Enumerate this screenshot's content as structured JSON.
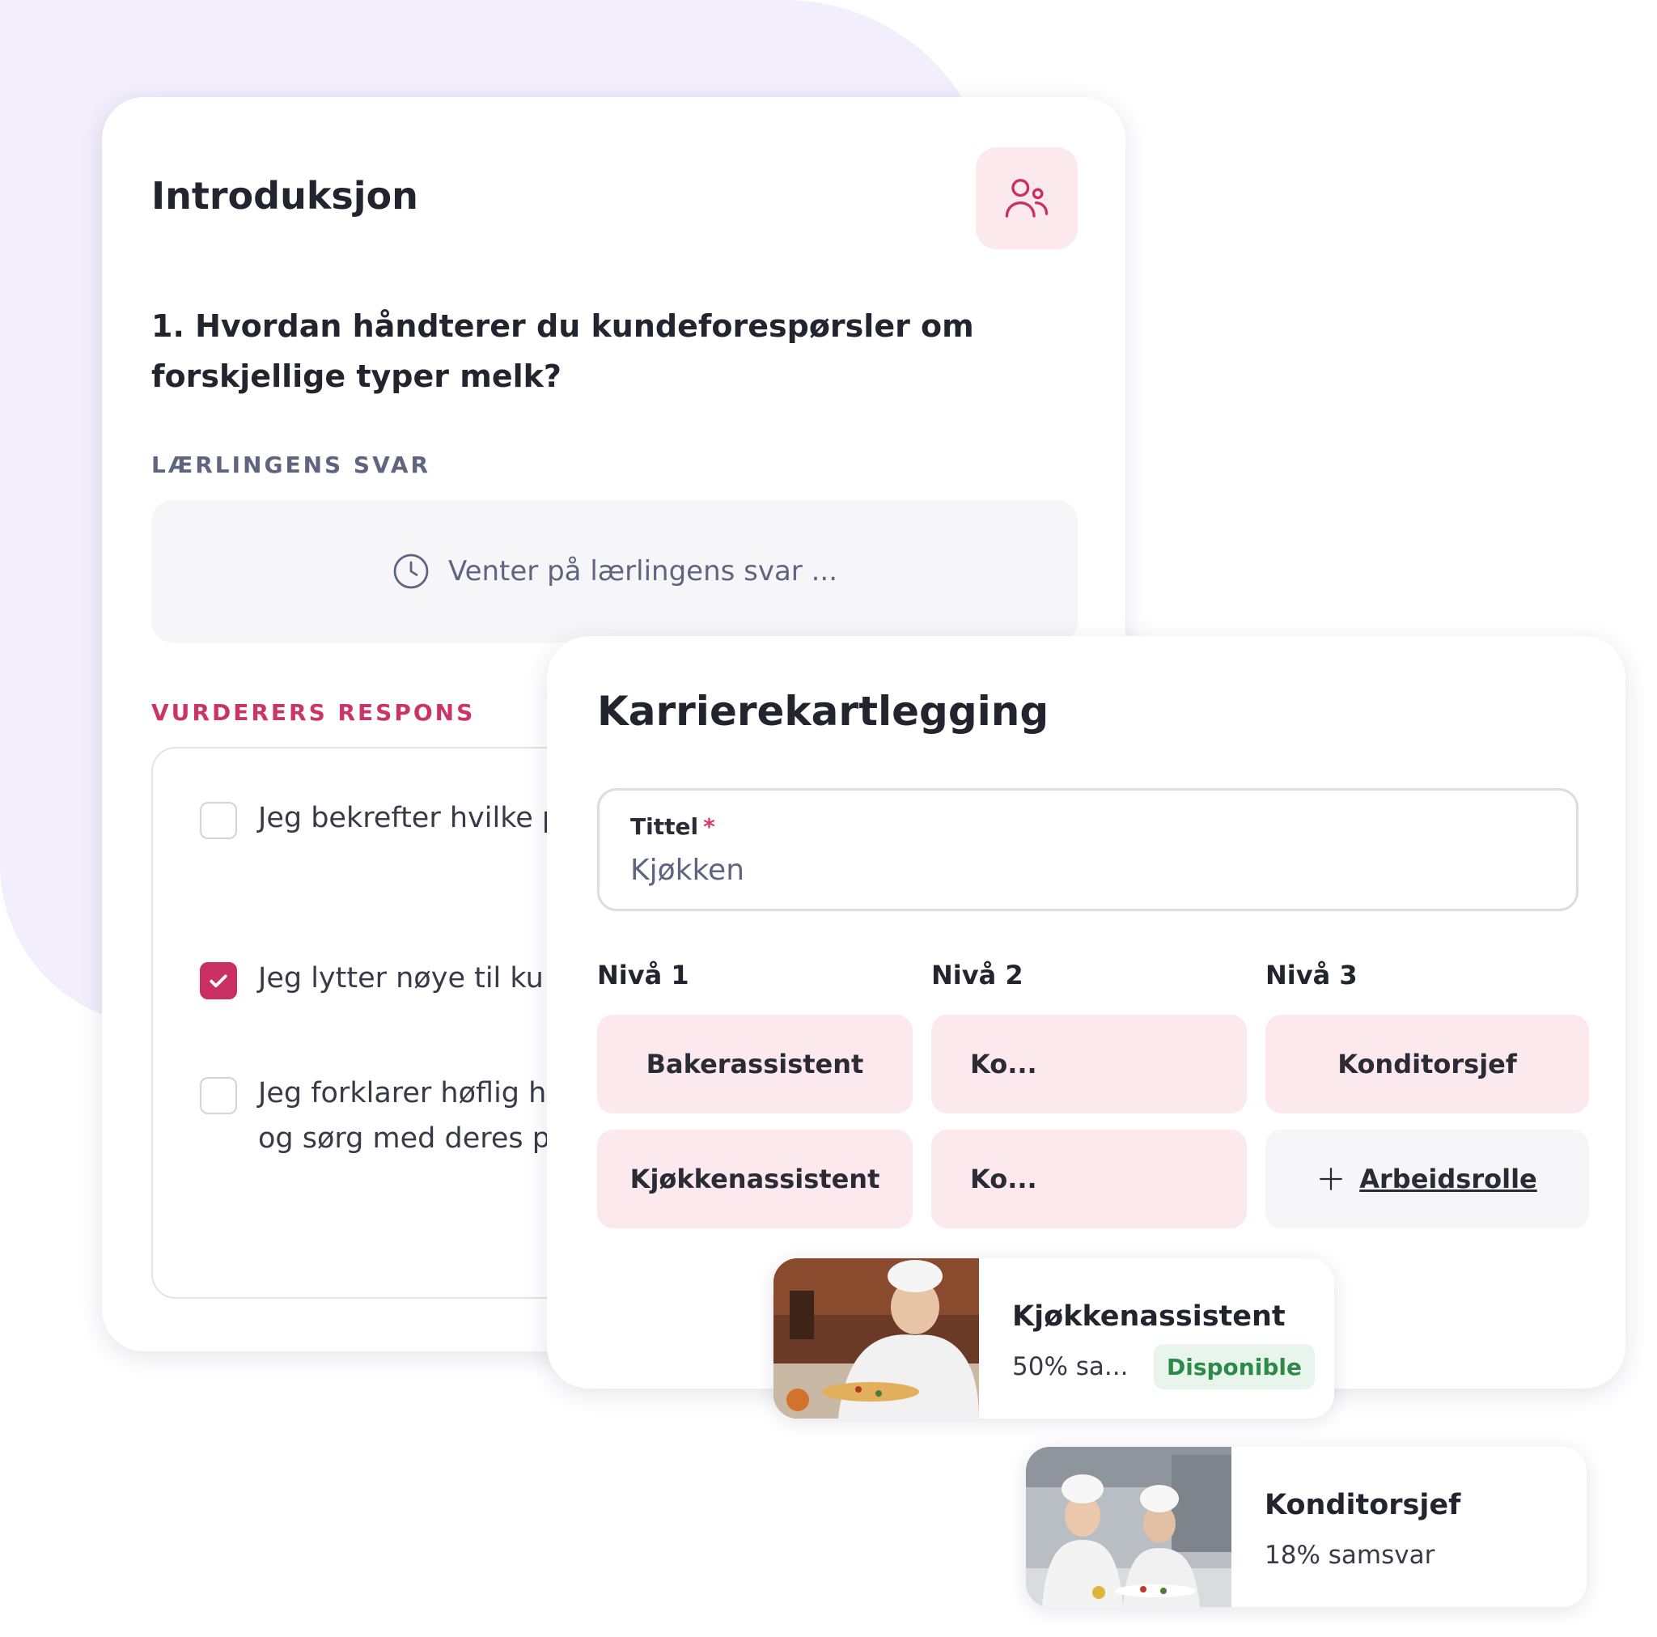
{
  "intro_card": {
    "title": "Introduksjon",
    "icon": "users-icon",
    "question": "1. Hvordan håndterer du kundeforespørsler om forskjellige typer melk?",
    "student_answer_label": "LÆRLINGENS SVAR",
    "waiting_text": "Venter på lærlingens svar ...",
    "assessor_label": "VURDERERS RESPONS",
    "options": [
      {
        "text": "Jeg bekrefter hvilke passende alternative tilgjengelig.",
        "checked": false
      },
      {
        "text": "Jeg lytter nøye til ku drikken blir laget ak",
        "checked": true
      },
      {
        "text": "Jeg forklarer høflig h eksempel helmelk, l havremelk — og sørg med deres preferans",
        "checked": false
      }
    ]
  },
  "career_card": {
    "title": "Karrierekartlegging",
    "field_label": "Tittel",
    "field_required_mark": "*",
    "field_value": "Kjøkken",
    "levels": [
      "Nivå 1",
      "Nivå 2",
      "Nivå 3"
    ],
    "level1_roles": [
      "Bakerassistent",
      "Kjøkkenassistent"
    ],
    "level2_roles": [
      "Ko...",
      "Ko..."
    ],
    "level3_roles": [
      "Konditorsjef"
    ],
    "add_role_label": "Arbeidsrolle"
  },
  "matches": [
    {
      "title": "Kjøkkenassistent",
      "subtitle": "50% sa...",
      "badge": "Disponible"
    },
    {
      "title": "Konditorsjef",
      "subtitle": "18% samsvar"
    }
  ],
  "colors": {
    "accent": "#c92f63",
    "tile_pink": "#fbe9ee",
    "bg_lavender": "#f2eefc",
    "badge_green": "#2f8a4a"
  }
}
